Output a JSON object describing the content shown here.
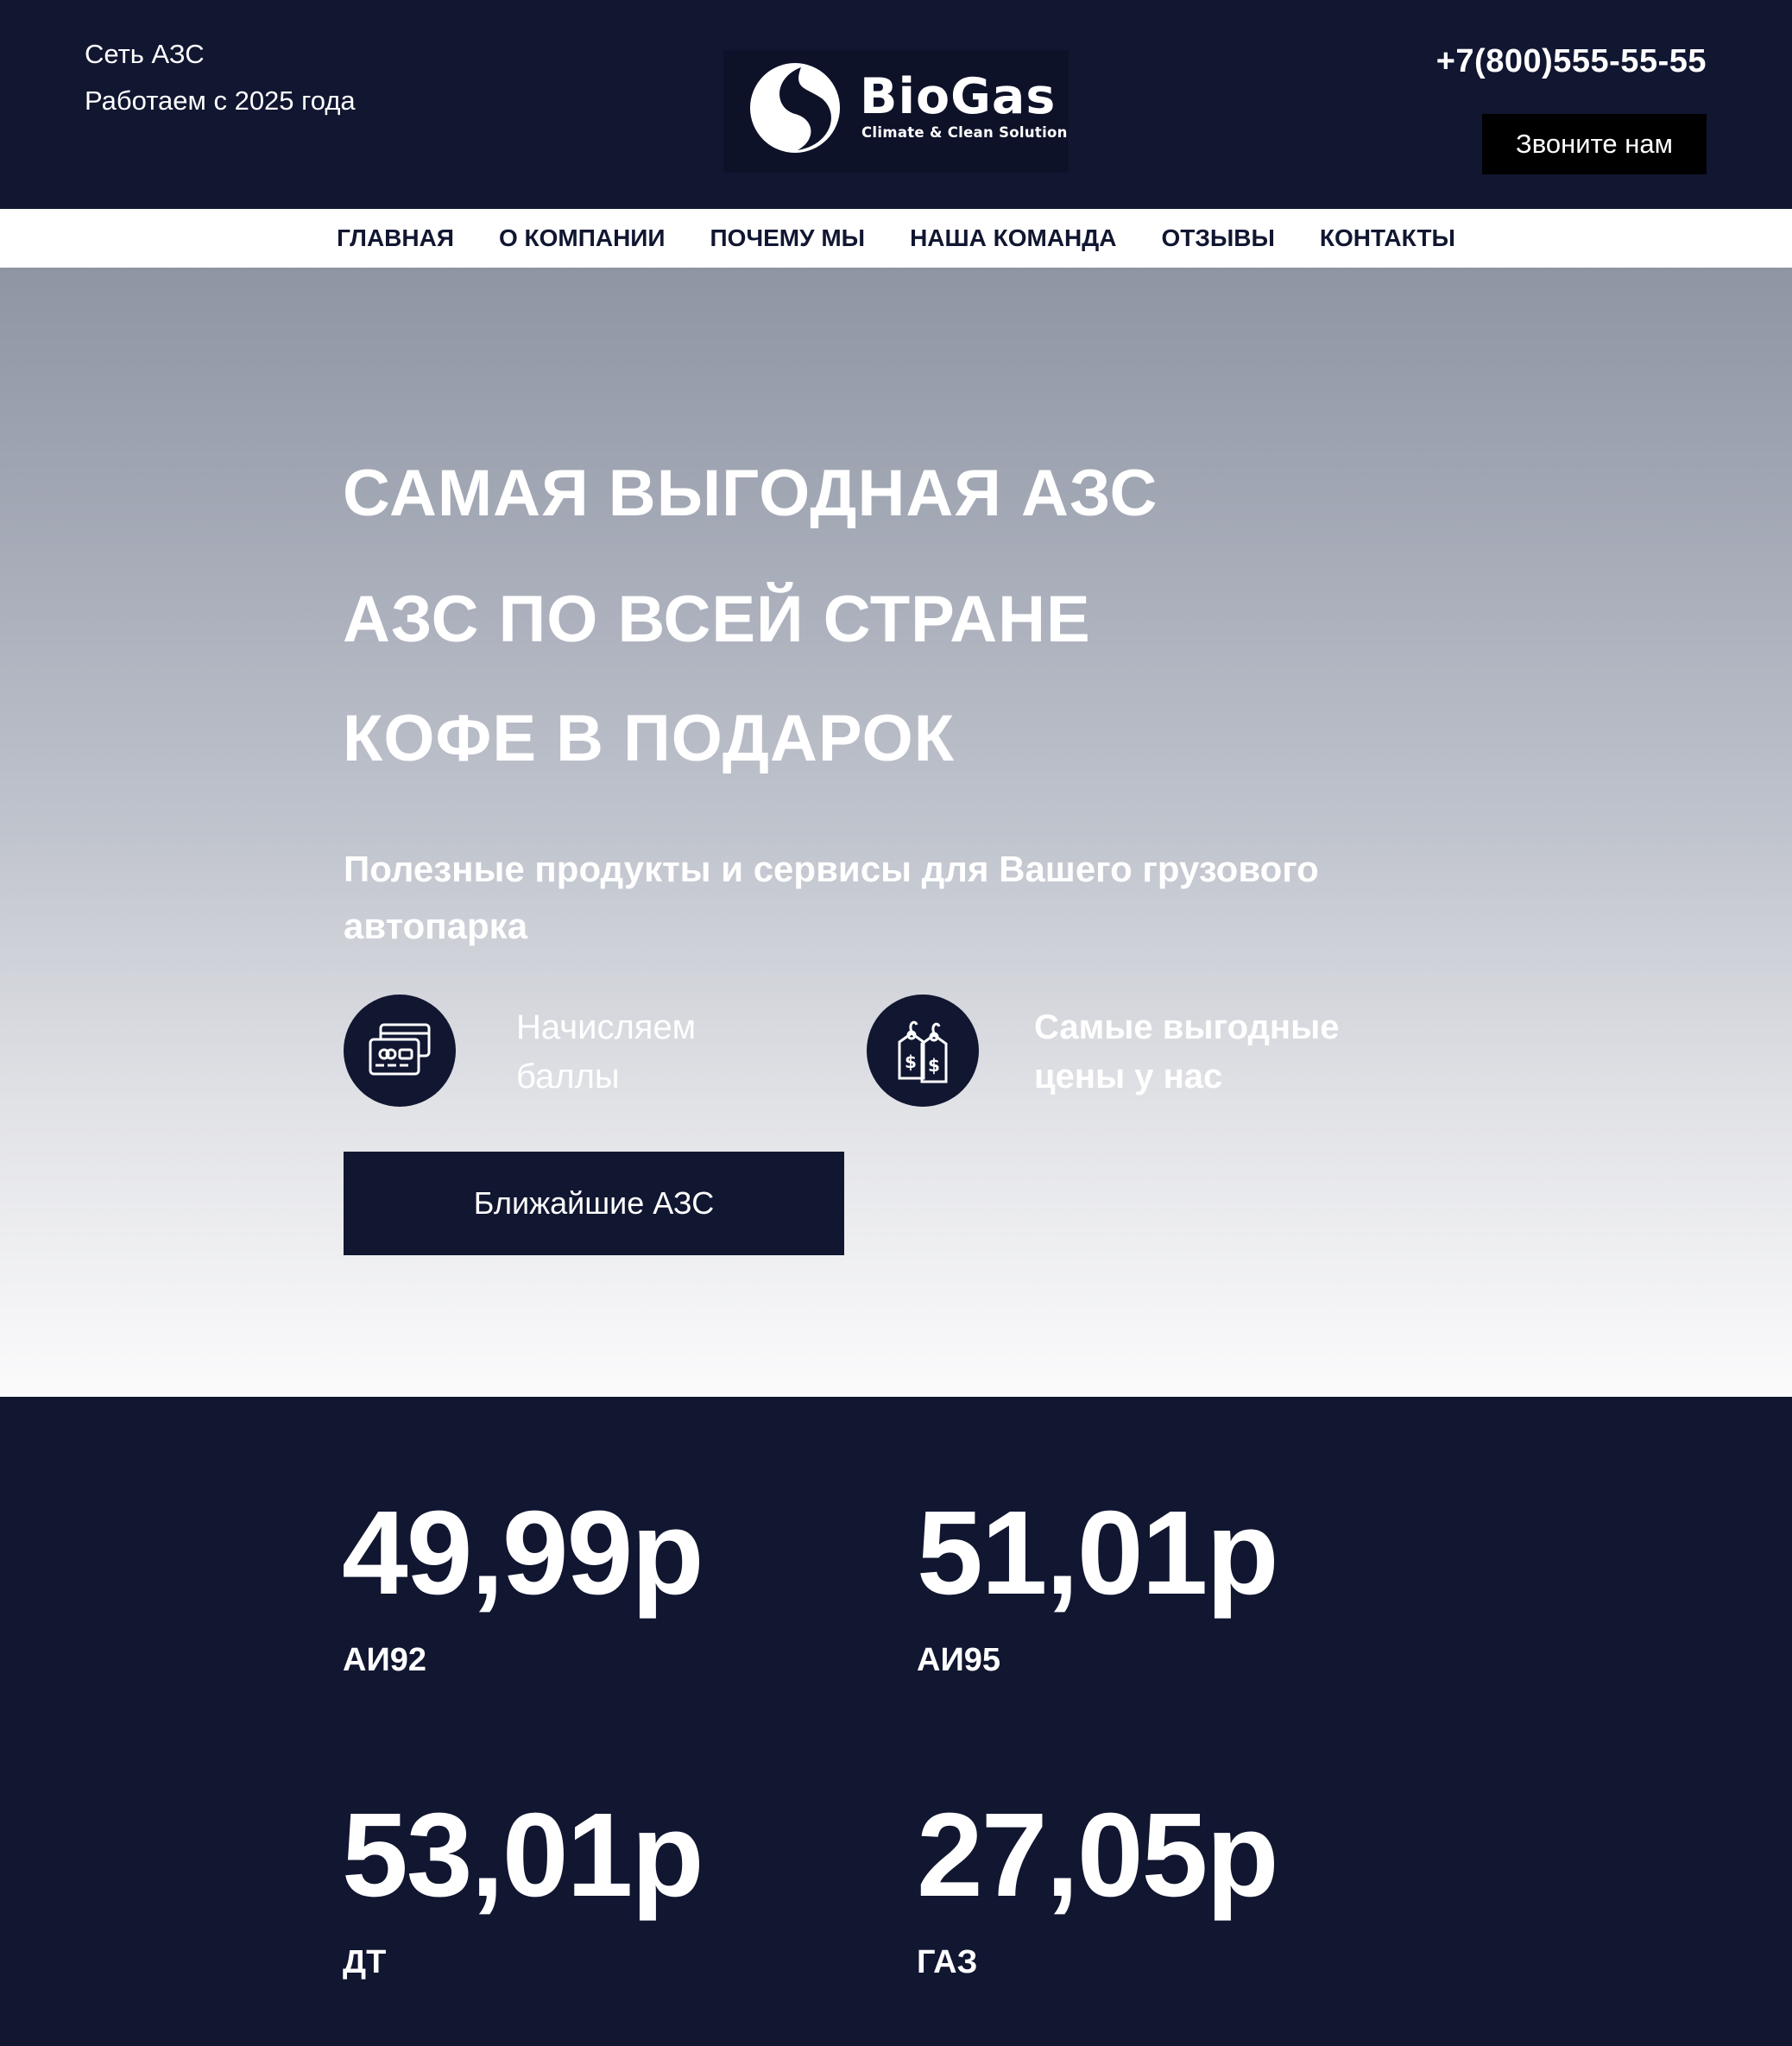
{
  "header": {
    "tagline_line1": "Сеть АЗС",
    "tagline_line2": "Работаем с 2025 года",
    "logo_name": "BioGas",
    "logo_subtitle": "Climate & Clean Solution",
    "phone": "+7(800)555-55-55",
    "call_button": "Звоните нам"
  },
  "nav": {
    "items": [
      {
        "label": "ГЛАВНАЯ"
      },
      {
        "label": "О КОМПАНИИ"
      },
      {
        "label": "ПОЧЕМУ МЫ"
      },
      {
        "label": "НАША КОМАНДА"
      },
      {
        "label": "ОТЗЫВЫ"
      },
      {
        "label": "КОНТАКТЫ"
      }
    ]
  },
  "hero": {
    "headline_1": "САМАЯ ВЫГОДНАЯ АЗС",
    "headline_2": "АЗС ПО ВСЕЙ СТРАНЕ",
    "headline_3": "КОФЕ В ПОДАРОК",
    "subtitle": "Полезные продукты и сервисы для Вашего грузового автопарка",
    "features": [
      {
        "icon": "credit-card-icon",
        "line1": "Начисляем",
        "line2": "баллы"
      },
      {
        "icon": "price-tags-icon",
        "line1": "Самые выгодные",
        "line2": "цены у нас"
      }
    ],
    "cta_button": "Ближайшие АЗС"
  },
  "prices": {
    "items": [
      {
        "value": "49,99р",
        "label": "АИ92"
      },
      {
        "value": "51,01р",
        "label": "АИ95"
      },
      {
        "value": "53,01р",
        "label": "ДТ"
      },
      {
        "value": "27,05р",
        "label": "ГАЗ"
      }
    ]
  },
  "colors": {
    "navy": "#111631",
    "white": "#ffffff",
    "black": "#000000"
  }
}
